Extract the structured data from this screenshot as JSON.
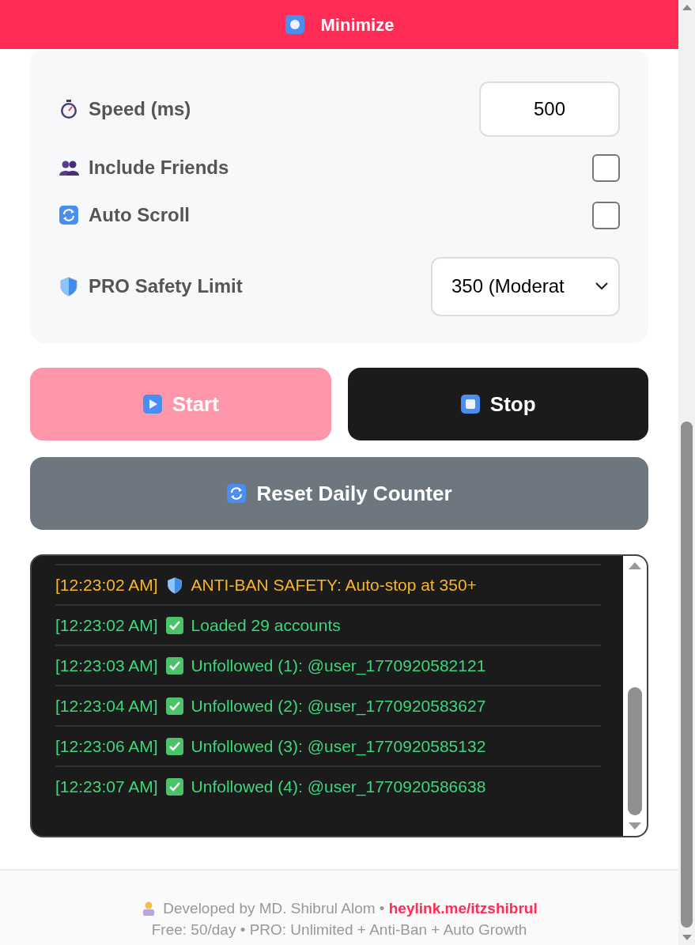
{
  "header": {
    "button": "Minimize"
  },
  "settings": [
    {
      "kind": "number",
      "label": "Speed (ms)",
      "value": "500"
    },
    {
      "kind": "checkbox",
      "label": "Include Friends",
      "checked": false
    },
    {
      "kind": "checkbox",
      "label": "Auto Scroll",
      "checked": false
    },
    {
      "kind": "select",
      "label": "PRO Safety Limit",
      "value": "350 (Moderat"
    }
  ],
  "actions": [
    {
      "label": "Start",
      "kind": "start",
      "disabled": true
    },
    {
      "label": "Stop",
      "kind": "stop",
      "disabled": false
    }
  ],
  "reset_button": "Reset Daily Counter",
  "log": [
    {
      "kind": "warning",
      "time": "[12:23:02 AM]",
      "message": "ANTI-BAN SAFETY: Auto-stop at 350+"
    },
    {
      "kind": "success",
      "time": "[12:23:02 AM]",
      "message": "Loaded 29 accounts"
    },
    {
      "kind": "success",
      "time": "[12:23:03 AM]",
      "message": "Unfollowed (1): @user_1770920582121"
    },
    {
      "kind": "success",
      "time": "[12:23:04 AM]",
      "message": "Unfollowed (2): @user_1770920583627"
    },
    {
      "kind": "success",
      "time": "[12:23:06 AM]",
      "message": "Unfollowed (3): @user_1770920585132"
    },
    {
      "kind": "success",
      "time": "[12:23:07 AM]",
      "message": "Unfollowed (4): @user_1770920586638"
    }
  ],
  "footer": {
    "credit": "Developed by MD. Shibrul Alom •",
    "link": "heylink.me/itzshibrul",
    "plans": "Free: 50/day • PRO: Unlimited + Anti-Ban + Auto Growth"
  }
}
